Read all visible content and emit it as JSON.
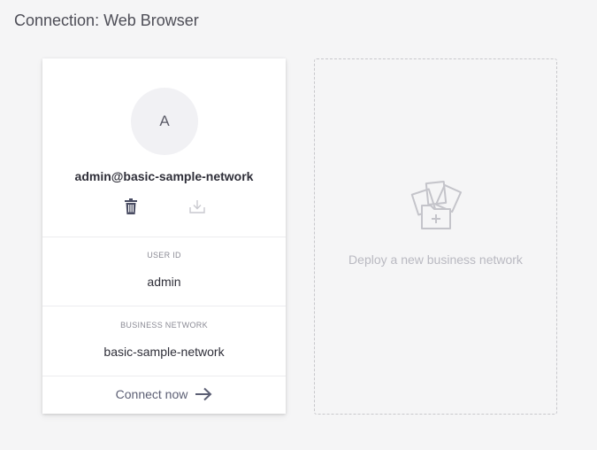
{
  "page": {
    "title": "Connection: Web Browser"
  },
  "identity_card": {
    "avatar_initial": "A",
    "identity_name": "admin@basic-sample-network",
    "actions": {
      "delete_icon": "trash-icon",
      "export_icon": "download-icon"
    },
    "user_id_label": "USER ID",
    "user_id_value": "admin",
    "network_label": "BUSINESS NETWORK",
    "network_value": "basic-sample-network",
    "connect_label": "Connect now",
    "connect_icon": "arrow-right-icon"
  },
  "deploy_card": {
    "label": "Deploy a new business network",
    "icon": "business-network-deploy-icon"
  },
  "colors": {
    "background": "#f5f5f6",
    "card": "#ffffff",
    "text_primary": "#2f2f39",
    "text_muted": "#8b8b95",
    "accent": "#5c5f74",
    "disabled": "#c9c9cf"
  }
}
